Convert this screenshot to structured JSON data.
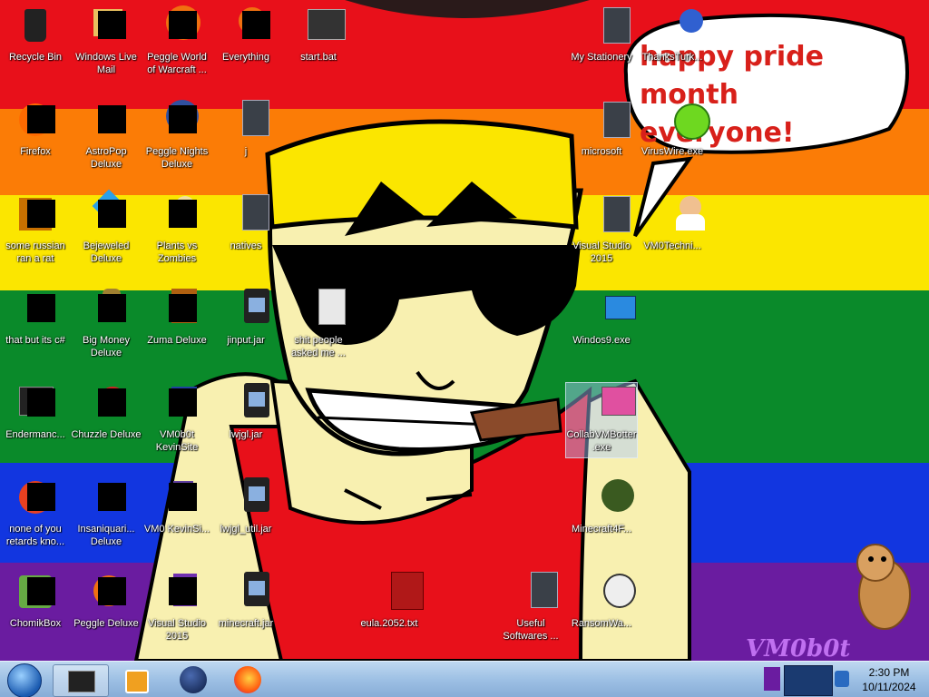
{
  "desktop": {
    "speech_bubble": {
      "line1": "happy pride month",
      "line2": "everyone!"
    },
    "watermark": "VM0b0t",
    "icons": [
      {
        "label": "Recycle Bin"
      },
      {
        "label": "Windows Live Mail"
      },
      {
        "label": "Peggle World of Warcraft ..."
      },
      {
        "label": "Everything"
      },
      {
        "label": "start.bat"
      },
      {
        "label": "My Stationery"
      },
      {
        "label": "ThanksTurk..."
      },
      {
        "label": "Firefox"
      },
      {
        "label": "AstroPop Deluxe"
      },
      {
        "label": "Peggle Nights Deluxe"
      },
      {
        "label": "j"
      },
      {
        "label": "microsoft"
      },
      {
        "label": "VirusWire.exe"
      },
      {
        "label": "some russian ran a rat"
      },
      {
        "label": "Bejeweled Deluxe"
      },
      {
        "label": "Plants vs Zombies"
      },
      {
        "label": "natives"
      },
      {
        "label": "Visual Studio 2015"
      },
      {
        "label": "VM0Techni..."
      },
      {
        "label": "that but its c#"
      },
      {
        "label": "Big Money Deluxe"
      },
      {
        "label": "Zuma Deluxe"
      },
      {
        "label": "jinput.jar"
      },
      {
        "label": "shit people asked me ..."
      },
      {
        "label": "Windos9.exe"
      },
      {
        "label": "Endermanc..."
      },
      {
        "label": "Chuzzle Deluxe"
      },
      {
        "label": "VM0b0t KevinSite"
      },
      {
        "label": "lwjgl.jar"
      },
      {
        "label": "CollabVMBotter.exe"
      },
      {
        "label": "none of you retards kno..."
      },
      {
        "label": "Insaniquari... Deluxe"
      },
      {
        "label": "VM0 KevinSi..."
      },
      {
        "label": "lwjgl_util.jar"
      },
      {
        "label": "Minecraft4F..."
      },
      {
        "label": "ChomikBox"
      },
      {
        "label": "Peggle Deluxe"
      },
      {
        "label": "Visual Studio 2015"
      },
      {
        "label": "minecraft.jar"
      },
      {
        "label": "eula.2052.txt"
      },
      {
        "label": "Useful Softwares ..."
      },
      {
        "label": "RansomWa..."
      }
    ]
  },
  "taskbar": {
    "clock": {
      "time": "2:30 PM",
      "date": "10/11/2024"
    }
  },
  "colors": {
    "red": "#e8101a",
    "orange": "#fb7c06",
    "yellow": "#fbe600",
    "green": "#0a8a2a",
    "blue": "#1236e0",
    "purple": "#6a1ca0"
  }
}
